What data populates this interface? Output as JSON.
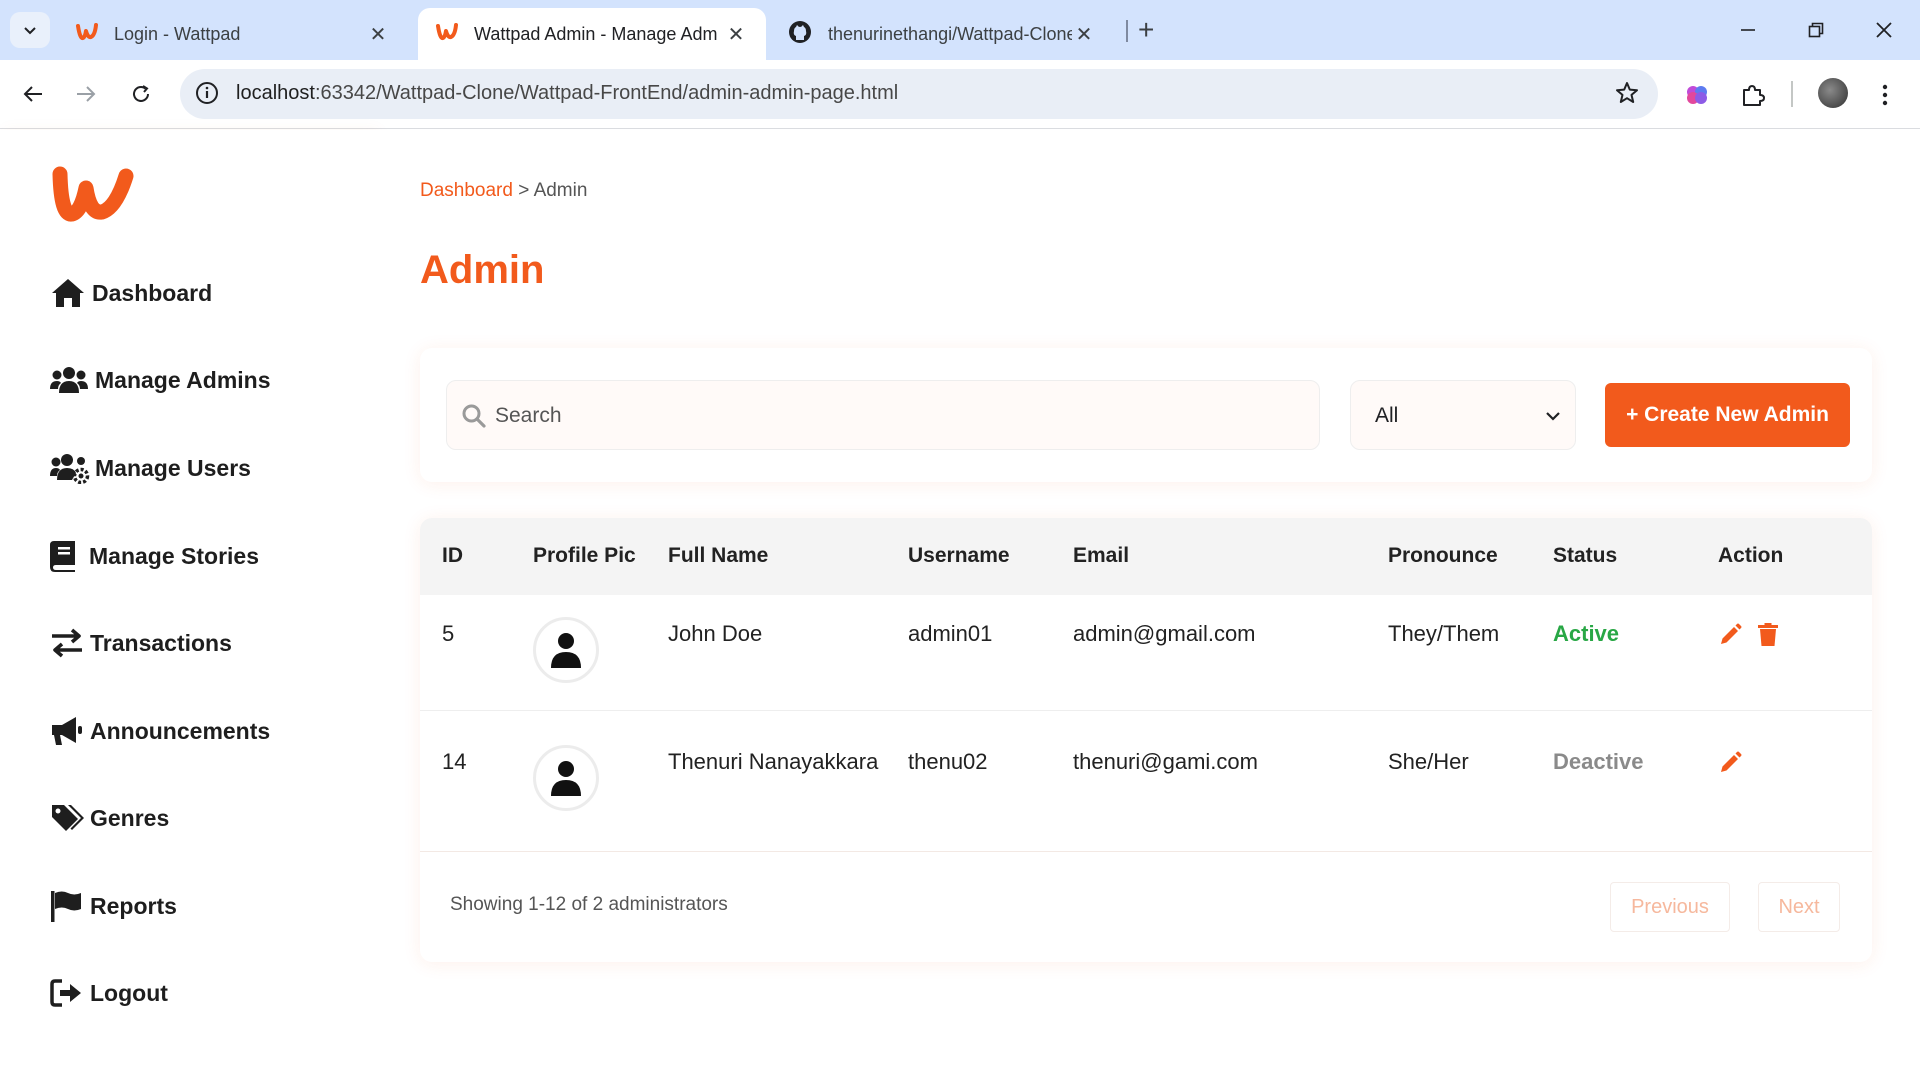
{
  "browser": {
    "tabs": [
      {
        "title": "Login - Wattpad"
      },
      {
        "title": "Wattpad Admin - Manage Adm"
      },
      {
        "title": "thenurinethangi/Wattpad-Clone"
      }
    ],
    "url_host": "localhost",
    "url_path": ":63342/Wattpad-Clone/Wattpad-FrontEnd/admin-admin-page.html",
    "icons": [
      "tab-search-icon",
      "wattpad-favicon-icon",
      "github-favicon-icon",
      "back-icon",
      "forward-icon",
      "reload-icon",
      "site-info-icon",
      "bookmark-star-icon",
      "extension-brain-icon",
      "extensions-puzzle-icon",
      "kebab-menu-icon"
    ]
  },
  "sidebar": {
    "items": [
      {
        "label": "Dashboard",
        "icon": "home-icon"
      },
      {
        "label": "Manage Admins",
        "icon": "users-icon"
      },
      {
        "label": "Manage Users",
        "icon": "users-cog-icon"
      },
      {
        "label": "Manage Stories",
        "icon": "book-icon"
      },
      {
        "label": "Transactions",
        "icon": "exchange-icon"
      },
      {
        "label": "Announcements",
        "icon": "bullhorn-icon"
      },
      {
        "label": "Genres",
        "icon": "tags-icon"
      },
      {
        "label": "Reports",
        "icon": "flag-icon"
      },
      {
        "label": "Logout",
        "icon": "logout-icon"
      }
    ]
  },
  "breadcrumb": {
    "link": "Dashboard",
    "separator": " > ",
    "current": "Admin"
  },
  "page_title": "Admin",
  "filters": {
    "search_placeholder": "Search",
    "status_selected": "All",
    "create_button": "+ Create New Admin"
  },
  "table": {
    "columns": [
      "ID",
      "Profile Pic",
      "Full Name",
      "Username",
      "Email",
      "Pronounce",
      "Status",
      "Action"
    ],
    "rows": [
      {
        "id": "5",
        "full_name": "John Doe",
        "username": "admin01",
        "email": "admin@gmail.com",
        "pronounce": "They/Them",
        "status": "Active"
      },
      {
        "id": "14",
        "full_name": "Thenuri Nanayakkara",
        "username": "thenu02",
        "email": "thenuri@gami.com",
        "pronounce": "She/Her",
        "status": "Deactive"
      }
    ],
    "footer": {
      "showing": "Showing 1-12 of 2 administrators",
      "previous": "Previous",
      "next": "Next"
    }
  },
  "colors": {
    "accent": "#f25a1c",
    "active": "#28a745",
    "deactive": "#8a8a8a"
  }
}
